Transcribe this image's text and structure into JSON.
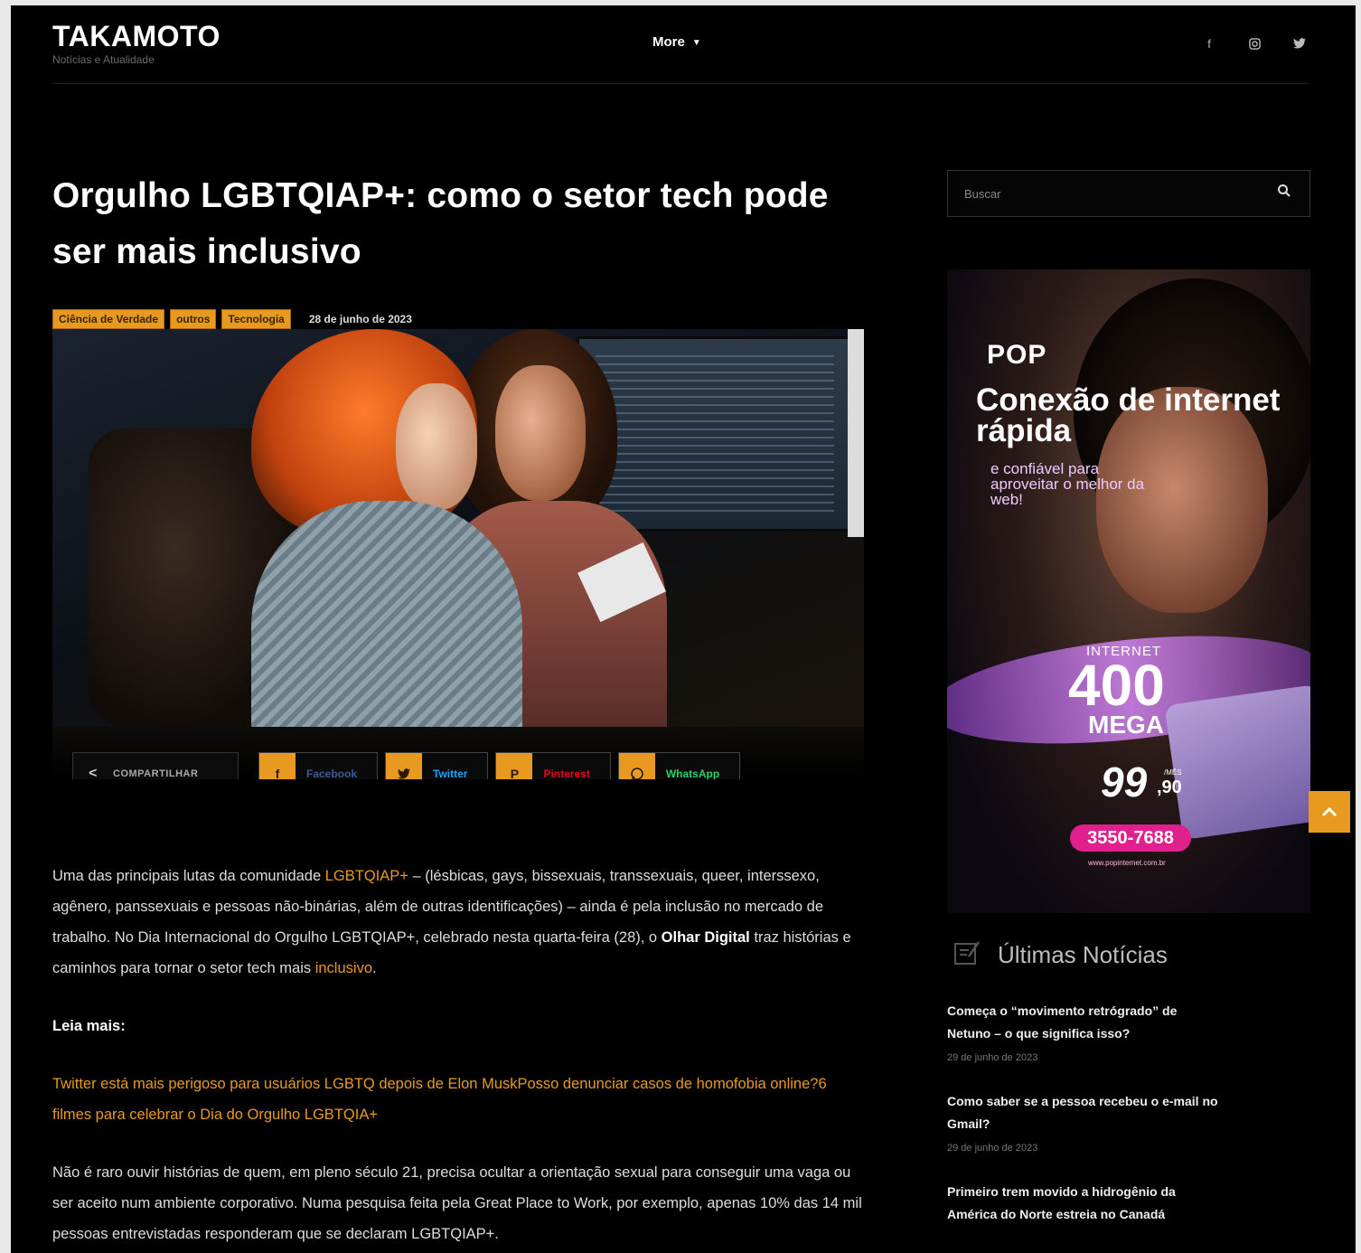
{
  "header": {
    "brand": "TAKAMOTO",
    "tagline": "Notícias e Atualidade",
    "nav_more": "More",
    "social_icons": [
      "facebook-icon",
      "instagram-icon",
      "twitter-icon"
    ]
  },
  "article": {
    "title": "Orgulho LGBTQIAP+: como o setor tech pode ser mais inclusivo",
    "categories": [
      "Ciência de Verdade",
      "outros",
      "Tecnologia"
    ],
    "date": "28 de junho de 2023",
    "share": {
      "label": "COMPARTILHAR",
      "facebook": "Facebook",
      "twitter": "Twitter",
      "pinterest": "Pinterest",
      "whatsapp": "WhatsApp"
    },
    "p1": {
      "a": "Uma das principais lutas da comunidade ",
      "link1": "LGBTQIAP+",
      "b": " – (lésbicas, gays, bissexuais, transsexuais, queer, interssexo, agênero, panssexuais e pessoas não-binárias, além de outras identificações) – ainda é pela inclusão no mercado de trabalho. No Dia Internacional do Orgulho LGBTQIAP+, celebrado nesta quarta-feira (28), o ",
      "bold": "Olhar Digital",
      "c": " traz histórias e caminhos para tornar o setor tech mais ",
      "link2": "inclusivo",
      "d": "."
    },
    "leia_mais": "Leia mais:",
    "leia_links": "Twitter está mais perigoso para usuários LGBTQ depois de Elon MuskPosso denunciar casos de homofobia online?6 filmes para celebrar o Dia do Orgulho LGBTQIA+",
    "p2": "Não é raro ouvir histórias de quem, em pleno século 21, precisa ocultar a orientação sexual para conseguir uma vaga ou ser aceito num ambiente corporativo. Numa pesquisa feita pela Great Place to Work, por exemplo, apenas 10% das 14 mil pessoas entrevistadas responderam que se declaram LGBTQIAP+."
  },
  "sidebar": {
    "search_placeholder": "Buscar",
    "ad": {
      "logo": "POP",
      "headline": "Conexão de internet rápida",
      "subline": "e confiável para aproveitar o melhor da web!",
      "internet": "INTERNET",
      "speed": "400",
      "unit": "MEGA",
      "price": "99",
      "cents": ",90",
      "per": "/MÊS",
      "phone": "3550-7688",
      "site": "www.popinternet.com.br"
    },
    "latest_title": "Últimas Notícias",
    "news": [
      {
        "title": "Começa o “movimento retrógrado” de Netuno – o que significa isso?",
        "date": "29 de junho de 2023"
      },
      {
        "title": "Como saber se a pessoa recebeu o e-mail no Gmail?",
        "date": "29 de junho de 2023"
      },
      {
        "title": "Primeiro trem movido a hidrogênio da América do Norte estreia no Canadá",
        "date": ""
      }
    ]
  },
  "colors": {
    "accent": "#e89a20",
    "background": "#000000"
  }
}
